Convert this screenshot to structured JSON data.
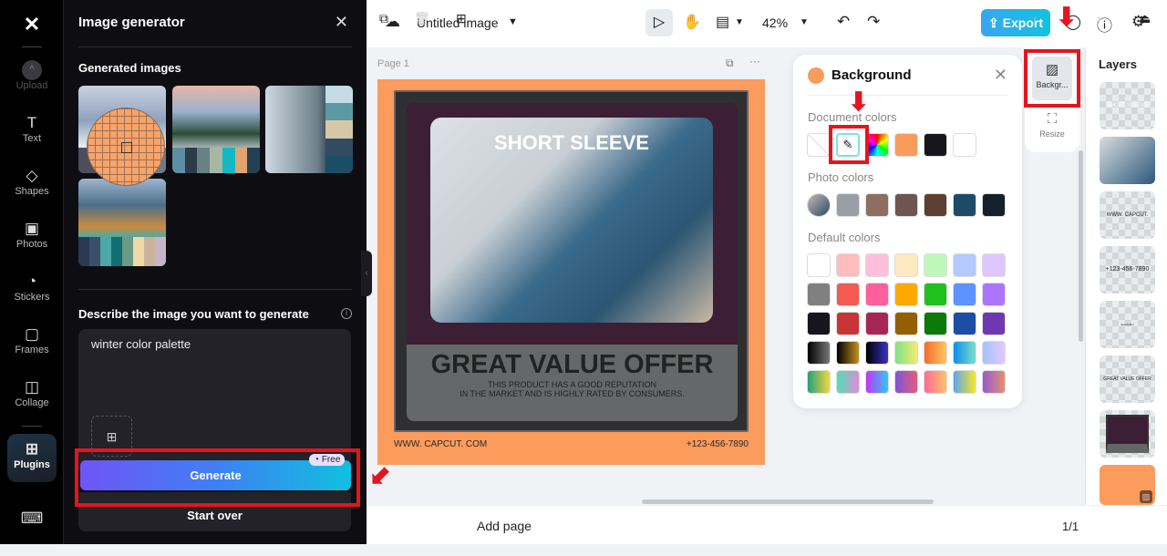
{
  "rail": {
    "logo": "CapCut",
    "items": [
      {
        "label": "Upload",
        "icon": "upload-icon"
      },
      {
        "label": "Text",
        "icon": "text-icon"
      },
      {
        "label": "Shapes",
        "icon": "shapes-icon"
      },
      {
        "label": "Photos",
        "icon": "photos-icon"
      },
      {
        "label": "Stickers",
        "icon": "stickers-icon"
      },
      {
        "label": "Frames",
        "icon": "frames-icon"
      },
      {
        "label": "Collage",
        "icon": "collage-icon"
      },
      {
        "label": "Plugins",
        "icon": "plugins-icon",
        "active": true
      }
    ],
    "keyboard_icon": "keyboard-icon"
  },
  "panel": {
    "title": "Image generator",
    "generated_heading": "Generated images",
    "describe_heading": "Describe the image you want to generate",
    "prompt_value": "winter color palette",
    "generate_label": "Generate",
    "free_badge": "Free",
    "start_over_label": "Start over"
  },
  "topbar": {
    "doc_title": "Untitled image",
    "zoom": "42%",
    "export_label": "Export"
  },
  "canvas": {
    "page_label": "Page 1",
    "headline": "SHORT SLEEVE",
    "offer": "GREAT VALUE OFFER",
    "desc_line1": "THIS PRODUCT HAS A GOOD  REPUTATION",
    "desc_line2": "IN THE MARKET AND IS HIGHLY RATED BY CONSUMERS.",
    "website": "WWW. CAPCUT. COM",
    "phone": "+123-456-7890",
    "background_color": "#fb9b5c"
  },
  "background_popup": {
    "title": "Background",
    "current_color": "#f99c5b",
    "document_colors_label": "Document colors",
    "document_colors": [
      "none",
      "eyedropper",
      "rainbow",
      "#f99c5b",
      "#16161c",
      "#ffffff"
    ],
    "photo_colors_label": "Photo colors",
    "photo_colors": [
      "photo",
      "#9b9ea5",
      "#8f6e62",
      "#6e5552",
      "#5e3f33",
      "#1d4b66",
      "#14202a"
    ],
    "default_colors_label": "Default colors",
    "default_colors": [
      [
        "#ffffff",
        "#ffbdbd",
        "#ffbfdc",
        "#ffe9c0",
        "#bff7bb",
        "#b3c9ff",
        "#dfc6ff"
      ],
      [
        "#808080",
        "#f25a52",
        "#ff5f9a",
        "#ffa800",
        "#21c01d",
        "#5d92ff",
        "#ad74ff"
      ],
      [
        "#16161c",
        "#c93434",
        "#a62755",
        "#945f00",
        "#0a7a09",
        "#1d4ea6",
        "#6e38b0"
      ],
      [
        "linear-gradient(90deg,#000,#777)",
        "linear-gradient(90deg,#000,#c49020)",
        "linear-gradient(90deg,#000,#3a30c8)",
        "linear-gradient(90deg,#7de28a,#f4ec6e)",
        "linear-gradient(90deg,#f46a2c,#fbc863)",
        "linear-gradient(90deg,#0c8ff0,#7ddcc7)",
        "linear-gradient(90deg,#a6c2ff,#e1c9ff)"
      ],
      [
        "linear-gradient(90deg,#23a07a,#f4d83c)",
        "linear-gradient(90deg,#4ee0b0,#e08ad8)",
        "linear-gradient(90deg,#c036f5,#2ec9f5)",
        "linear-gradient(90deg,#7d55dc,#e45c7a)",
        "linear-gradient(90deg,#ff6a9a,#ffc268)",
        "linear-gradient(90deg,#5ca6ef,#f6e828)",
        "linear-gradient(90deg,#955ad0,#e49070)"
      ]
    ]
  },
  "side_tools": {
    "background_label": "Backgr...",
    "resize_label": "Resize"
  },
  "layers": {
    "title": "Layers",
    "items": [
      "SHORT SLEEVE",
      "photo",
      "WWW. CAPCUT. COM",
      "+123-456-7890",
      "description",
      "GREAT VALUE OFFER",
      "frame",
      "background"
    ]
  },
  "bottombar": {
    "add_page_label": "Add page",
    "page_counter": "1/1"
  }
}
